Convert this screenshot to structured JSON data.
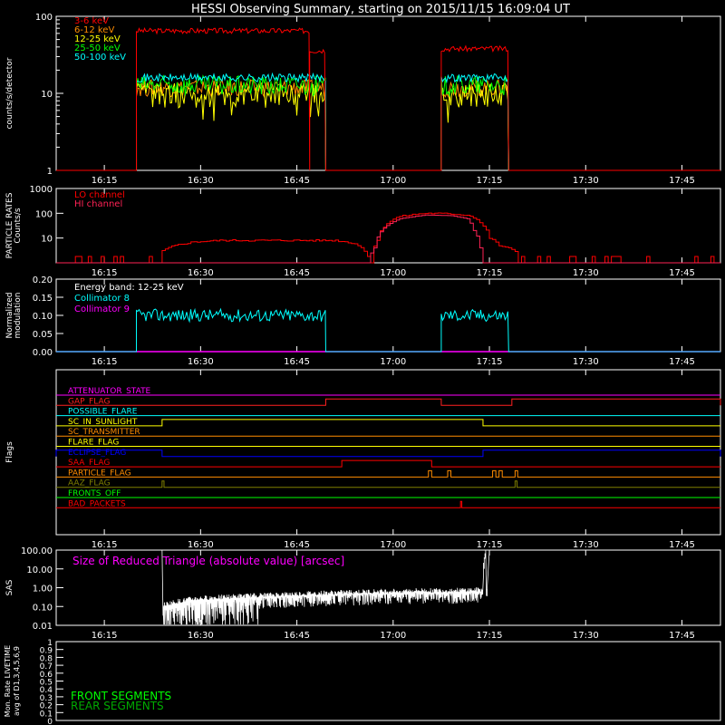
{
  "title": "HESSI Observing Summary, starting on 2015/11/15 16:09:04 UT",
  "time_ticks": [
    "16:15",
    "16:30",
    "16:45",
    "17:00",
    "17:15",
    "17:30",
    "17:45"
  ],
  "time_tick_minutes": [
    6,
    21,
    36,
    51,
    66,
    81,
    96
  ],
  "time_range_min": [
    -1.5,
    102
  ],
  "chart_data": [
    {
      "type": "line",
      "panel": "count-rates",
      "ylabel": "counts/s/detector",
      "yscale": "log",
      "ylim": [
        1,
        100
      ],
      "yticks": [
        "1",
        "10",
        "100"
      ],
      "series": [
        {
          "name": "3-6 keV",
          "color": "#ff0000",
          "segments": [
            {
              "start": 11,
              "end": 38,
              "level": 65
            },
            {
              "start": 38,
              "end": 40.5,
              "level": 36
            },
            {
              "start": 58.5,
              "end": 69,
              "level": 38
            }
          ]
        },
        {
          "name": "6-12 keV",
          "color": "#ff8c00",
          "segments": [
            {
              "start": 11,
              "end": 40.5,
              "level": 12
            },
            {
              "start": 58.5,
              "end": 69,
              "level": 12
            }
          ]
        },
        {
          "name": "12-25 keV",
          "color": "#ffff00",
          "segments": [
            {
              "start": 11,
              "end": 40.5,
              "level": 10
            },
            {
              "start": 58.5,
              "end": 69,
              "level": 10
            }
          ]
        },
        {
          "name": "25-50 keV",
          "color": "#00ff00",
          "segments": [
            {
              "start": 11,
              "end": 40.5,
              "level": 13
            },
            {
              "start": 58.5,
              "end": 69,
              "level": 13
            }
          ]
        },
        {
          "name": "50-100 keV",
          "color": "#00ffff",
          "segments": [
            {
              "start": 11,
              "end": 40.5,
              "level": 16
            },
            {
              "start": 58.5,
              "end": 69,
              "level": 16
            }
          ]
        }
      ]
    },
    {
      "type": "line",
      "panel": "particle-rates",
      "ylabel": "PARTICLE RATES Counts/s",
      "yscale": "log",
      "ylim": [
        1,
        1000
      ],
      "yticks": [
        "10",
        "100",
        "1000"
      ],
      "series": [
        {
          "name": "LO channel",
          "color": "#ff0000"
        },
        {
          "name": "HI channel",
          "color": "#ff2255"
        }
      ],
      "lo_points": [
        [
          -1.5,
          1
        ],
        [
          7,
          1
        ],
        [
          10,
          1.5
        ],
        [
          14,
          2
        ],
        [
          17,
          5
        ],
        [
          20,
          7
        ],
        [
          24,
          8
        ],
        [
          30,
          8
        ],
        [
          36,
          8
        ],
        [
          42,
          8
        ],
        [
          45,
          6
        ],
        [
          46.5,
          3
        ],
        [
          47.5,
          2
        ],
        [
          48.5,
          8
        ],
        [
          50,
          40
        ],
        [
          52,
          75
        ],
        [
          56,
          100
        ],
        [
          60,
          95
        ],
        [
          63,
          80
        ],
        [
          65,
          30
        ],
        [
          66,
          10
        ],
        [
          67.5,
          5
        ],
        [
          70,
          3
        ],
        [
          76,
          2
        ],
        [
          82,
          1.5
        ],
        [
          86,
          1
        ],
        [
          102,
          1
        ]
      ],
      "hi_points": [
        [
          -1.5,
          1
        ],
        [
          47,
          1
        ],
        [
          48,
          4
        ],
        [
          49.5,
          25
        ],
        [
          52,
          60
        ],
        [
          56,
          85
        ],
        [
          60,
          80
        ],
        [
          62.5,
          60
        ],
        [
          63.5,
          20
        ],
        [
          64.5,
          4
        ],
        [
          65,
          1
        ],
        [
          102,
          1
        ]
      ]
    },
    {
      "type": "line",
      "panel": "modulation",
      "ylabel": "Normalized modulation",
      "ylim": [
        0,
        0.2
      ],
      "yticks": [
        "0.00",
        "0.05",
        "0.10",
        "0.15",
        "0.20"
      ],
      "annotation": "Energy band: 12-25 keV",
      "series": [
        {
          "name": "Collimator 8",
          "color": "#00ffff",
          "segments": [
            {
              "start": 11,
              "end": 40.5,
              "level": 0.1
            },
            {
              "start": 58.5,
              "end": 69,
              "level": 0.1
            }
          ]
        },
        {
          "name": "Collimator 9",
          "color": "#ff00ff",
          "level": 0.0
        }
      ]
    },
    {
      "type": "step",
      "panel": "flags",
      "ylabel": "Flags",
      "series": [
        {
          "name": "ATTENUATOR_STATE",
          "color": "#ff00ff",
          "high": []
        },
        {
          "name": "GAP_FLAG",
          "color": "#ff2020",
          "high": [
            [
              40.5,
              58.5
            ],
            [
              69.5,
              102
            ]
          ]
        },
        {
          "name": "POSSIBLE_FLARE",
          "color": "#00ffff",
          "high": []
        },
        {
          "name": "SC_IN_SUNLIGHT",
          "color": "#ffff00",
          "high": [
            [
              15,
              65
            ]
          ]
        },
        {
          "name": "SC_TRANSMITTER",
          "color": "#ff8c00",
          "high": []
        },
        {
          "name": "FLARE_FLAG",
          "color": "#ffff00",
          "high": []
        },
        {
          "name": "ECLIPSE_FLAG",
          "color": "#0000ff",
          "high": [
            [
              -1.5,
              15
            ],
            [
              65,
              102
            ]
          ]
        },
        {
          "name": "SAA_FLAG",
          "color": "#ff0000",
          "high": [
            [
              43,
              57
            ]
          ]
        },
        {
          "name": "PARTICLE_FLAG",
          "color": "#ff8c00",
          "high": [
            [
              56.5,
              57
            ],
            [
              59.5,
              60
            ],
            [
              66.5,
              67
            ],
            [
              67.5,
              68
            ],
            [
              70,
              70.4
            ]
          ]
        },
        {
          "name": "AAZ_FLAG",
          "color": "#808000",
          "high": [
            [
              15,
              15.3
            ],
            [
              70,
              70.3
            ]
          ]
        },
        {
          "name": "FRONTS_OFF",
          "color": "#00ff00",
          "high": []
        },
        {
          "name": "BAD_PACKETS",
          "color": "#ff0000",
          "high": [
            [
              61.5,
              61.7
            ]
          ]
        }
      ]
    },
    {
      "type": "line",
      "panel": "sas",
      "ylabel": "SAS",
      "yscale": "log",
      "ylim": [
        0.01,
        100
      ],
      "yticks": [
        "0.01",
        "0.10",
        "1.00",
        "10.00",
        "100.00"
      ],
      "annotation": "Size of Reduced Triangle (absolute value) [arcsec]",
      "series": [
        {
          "name": "Size of Reduced Triangle",
          "color": "#ffffff",
          "start": 15,
          "end": 66,
          "points": [
            [
              15,
              100
            ],
            [
              15.5,
              0.1
            ],
            [
              20,
              0.2
            ],
            [
              25,
              0.25
            ],
            [
              30,
              0.3
            ],
            [
              35,
              0.35
            ],
            [
              40,
              0.4
            ],
            [
              45,
              0.45
            ],
            [
              50,
              0.5
            ],
            [
              55,
              0.55
            ],
            [
              60,
              0.55
            ],
            [
              65,
              0.6
            ],
            [
              65.5,
              100
            ]
          ]
        }
      ]
    },
    {
      "type": "line",
      "panel": "livetime",
      "ylabel": "Mon. Rate LIVETIME avg of D1,3,4,5,6,9",
      "ylim": [
        0,
        1
      ],
      "yticks": [
        "0",
        "0.1",
        "0.2",
        "0.3",
        "0.4",
        "0.5",
        "0.6",
        "0.7",
        "0.8",
        "0.9",
        "1"
      ],
      "series": [
        {
          "name": "FRONT SEGMENTS",
          "color": "#00ff00"
        },
        {
          "name": "REAR SEGMENTS",
          "color": "#00aa00"
        }
      ]
    }
  ]
}
